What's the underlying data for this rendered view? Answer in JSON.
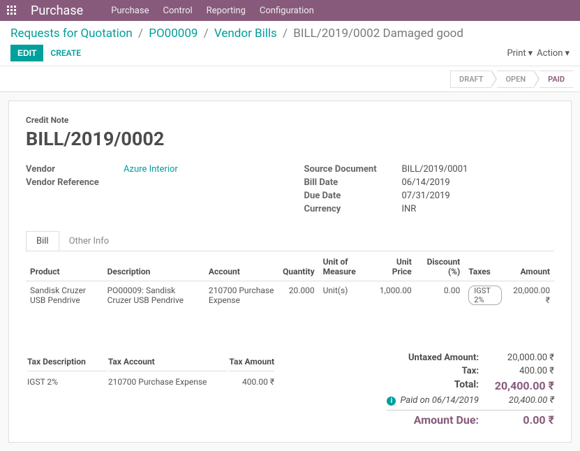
{
  "topbar": {
    "app": "Purchase",
    "menu": [
      "Purchase",
      "Control",
      "Reporting",
      "Configuration"
    ]
  },
  "breadcrumb": {
    "items": [
      "Requests for Quotation",
      "PO00009",
      "Vendor Bills"
    ],
    "current": "BILL/2019/0002 Damaged good"
  },
  "buttons": {
    "edit": "EDIT",
    "create": "CREATE",
    "print": "Print",
    "action": "Action"
  },
  "status": {
    "draft": "DRAFT",
    "open": "OPEN",
    "paid": "PAID"
  },
  "doc": {
    "subtitle": "Credit Note",
    "name": "BILL/2019/0002",
    "vendor_label": "Vendor",
    "vendor": "Azure Interior",
    "vendor_ref_label": "Vendor Reference",
    "source_label": "Source Document",
    "source": "BILL/2019/0001",
    "bill_date_label": "Bill Date",
    "bill_date": "06/14/2019",
    "due_date_label": "Due Date",
    "due_date": "07/31/2019",
    "currency_label": "Currency",
    "currency": "INR"
  },
  "tabs": {
    "bill": "Bill",
    "other": "Other Info"
  },
  "line_headers": {
    "product": "Product",
    "desc": "Description",
    "account": "Account",
    "qty": "Quantity",
    "uom": "Unit of Measure",
    "price": "Unit Price",
    "discount": "Discount (%)",
    "taxes": "Taxes",
    "amount": "Amount"
  },
  "lines": [
    {
      "product": "Sandisk Cruzer USB Pendrive",
      "desc": "PO00009: Sandisk Cruzer USB Pendrive",
      "account": "210700 Purchase Expense",
      "qty": "20.000",
      "uom": "Unit(s)",
      "price": "1,000.00",
      "discount": "0.00",
      "tax": "IGST 2%",
      "amount": "20,000.00 ₹"
    }
  ],
  "tax_headers": {
    "desc": "Tax Description",
    "account": "Tax Account",
    "amount": "Tax Amount"
  },
  "tax_lines": [
    {
      "desc": "IGST 2%",
      "account": "210700 Purchase Expense",
      "amount": "400.00 ₹"
    }
  ],
  "totals": {
    "untaxed_label": "Untaxed Amount:",
    "untaxed": "20,000.00 ₹",
    "tax_label": "Tax:",
    "tax": "400.00 ₹",
    "total_label": "Total:",
    "total": "20,400.00 ₹",
    "paid_label": "Paid on 06/14/2019",
    "paid": "20,400.00 ₹",
    "due_label": "Amount Due:",
    "due": "0.00 ₹"
  }
}
